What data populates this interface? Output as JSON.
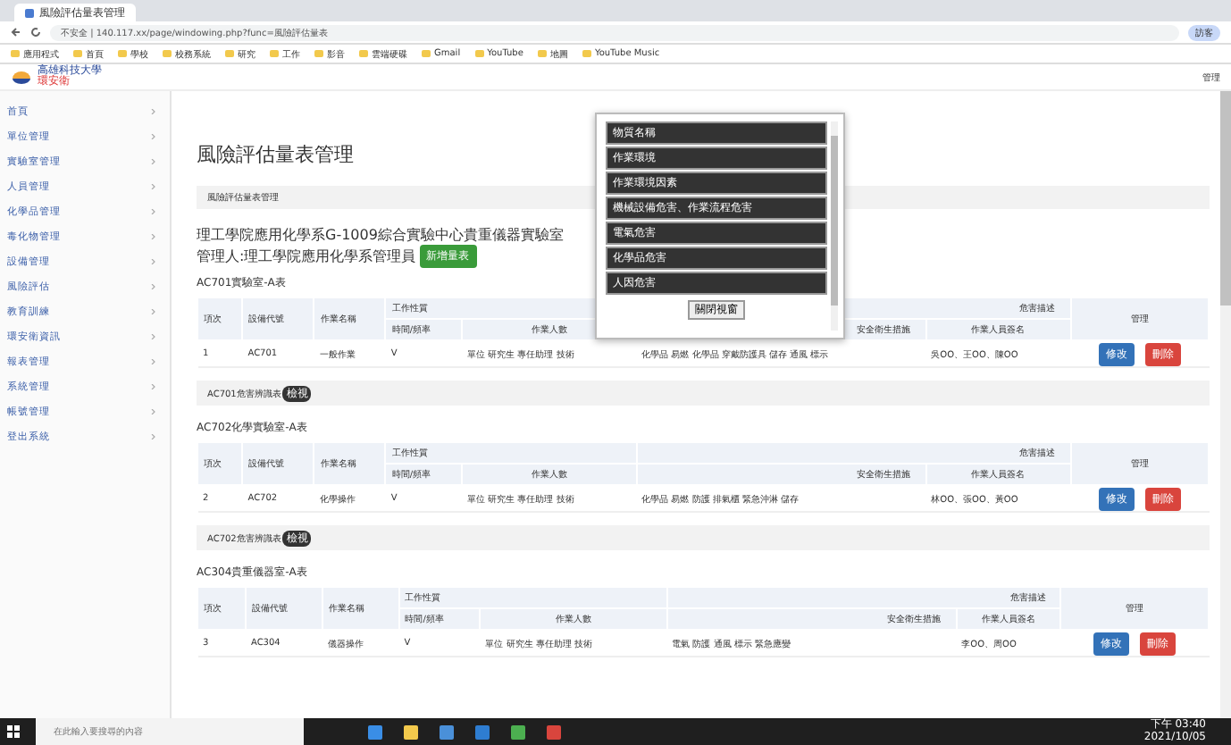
{
  "browser": {
    "tab_title": "風險評估量表管理",
    "url": "不安全 | 140.117.xx/page/windowing.php?func=風險評估量表",
    "bookmarks": [
      "應用程式",
      "首頁",
      "學校",
      "校務系統",
      "研究",
      "工作",
      "影音",
      "雲端硬碟",
      "Gmail",
      "YouTube",
      "地圖",
      "YouTube Music"
    ],
    "profile": "訪客"
  },
  "app": {
    "logo_top": "高雄科技大學",
    "logo_bottom": "環安衛",
    "user": "管理"
  },
  "sidebar": {
    "items": [
      {
        "label": "首頁"
      },
      {
        "label": "單位管理"
      },
      {
        "label": "實驗室管理"
      },
      {
        "label": "人員管理"
      },
      {
        "label": "化學品管理"
      },
      {
        "label": "毒化物管理"
      },
      {
        "label": "設備管理"
      },
      {
        "label": "風險評估"
      },
      {
        "label": "教育訓練"
      },
      {
        "label": "環安衛資訊"
      },
      {
        "label": "報表管理"
      },
      {
        "label": "系統管理"
      },
      {
        "label": "帳號管理"
      },
      {
        "label": "登出系統"
      }
    ]
  },
  "page": {
    "title": "風險評估量表管理",
    "breadcrumb": "風險評估量表管理",
    "heading_line1": "理工學院應用化學系G-1009綜合實驗中心貴重儀器實驗室",
    "heading_line2": "管理人:理工學院應用化學系管理員",
    "add_button": "新增量表"
  },
  "tables": [
    {
      "title": "AC701實驗室-A表",
      "headers": [
        "項次",
        "設備代號",
        "作業名稱",
        "工作性質",
        "危害描述",
        "管理"
      ],
      "subheaders": [
        "時間/頻率",
        "作業人數",
        "安全衛生措施",
        "作業人員簽名"
      ],
      "row": [
        "1",
        "AC701",
        "一般作業",
        "V",
        "單位 研究生 專任助理 技術",
        "化學品 易燃 化學品 穿戴防護具 儲存 通風 標示",
        "吳OO、王OO、陳OO"
      ],
      "actions": [
        "修改",
        "刪除"
      ],
      "footer": "AC701危害辨識表",
      "badge": "檢視"
    },
    {
      "title": "AC702化學實驗室-A表",
      "headers": [
        "項次",
        "設備代號",
        "作業名稱",
        "工作性質",
        "危害描述",
        "管理"
      ],
      "subheaders": [
        "時間/頻率",
        "作業人數",
        "安全衛生措施",
        "作業人員簽名"
      ],
      "row": [
        "2",
        "AC702",
        "化學操作",
        "V",
        "單位 研究生 專任助理 技術",
        "化學品 易燃 防護 排氣櫃 緊急沖淋 儲存",
        "林OO、張OO、黃OO"
      ],
      "actions": [
        "修改",
        "刪除"
      ],
      "footer": "AC702危害辨識表",
      "badge": "檢視"
    },
    {
      "title": "AC304貴重儀器室-A表",
      "headers": [
        "項次",
        "設備代號",
        "作業名稱",
        "工作性質",
        "危害描述",
        "管理"
      ],
      "subheaders": [
        "時間/頻率",
        "作業人數",
        "安全衛生措施",
        "作業人員簽名"
      ],
      "row": [
        "3",
        "AC304",
        "儀器操作",
        "V",
        "單位 研究生 專任助理 技術",
        "電氣 防護 通風 標示 緊急應變",
        "李OO、周OO"
      ],
      "actions": [
        "修改",
        "刪除"
      ]
    }
  ],
  "popup": {
    "items": [
      "物質名稱",
      "作業環境",
      "作業環境因素",
      "機械設備危害、作業流程危害",
      "電氣危害",
      "化學品危害",
      "人因危害"
    ],
    "close_button": "關閉視窗"
  },
  "taskbar": {
    "search_placeholder": "在此輸入要搜尋的內容",
    "time": "下午 03:40",
    "date": "2021/10/05"
  }
}
